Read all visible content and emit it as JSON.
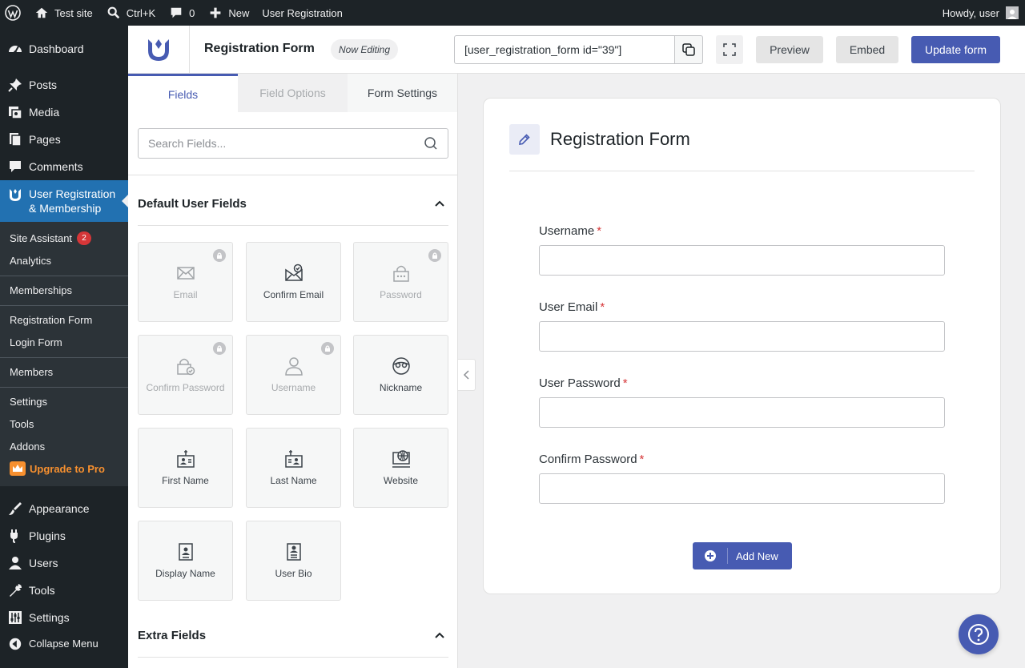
{
  "admin_bar": {
    "site_name": "Test site",
    "search_shortcut": "Ctrl+K",
    "comments_count": "0",
    "new_label": "New",
    "plugin_link": "User Registration",
    "greeting": "Howdy, user"
  },
  "sidebar": {
    "dashboard": "Dashboard",
    "posts": "Posts",
    "media": "Media",
    "pages": "Pages",
    "comments": "Comments",
    "user_registration": "User Registration & Membership",
    "submenu": {
      "site_assistant": "Site Assistant",
      "site_assistant_badge": "2",
      "analytics": "Analytics",
      "memberships": "Memberships",
      "registration_form": "Registration Form",
      "login_form": "Login Form",
      "members": "Members",
      "settings": "Settings",
      "tools": "Tools",
      "addons": "Addons",
      "upgrade": "Upgrade to Pro"
    },
    "appearance": "Appearance",
    "plugins": "Plugins",
    "users": "Users",
    "tools": "Tools",
    "settings": "Settings",
    "collapse": "Collapse Menu"
  },
  "header": {
    "form_title": "Registration Form",
    "status_badge": "Now Editing",
    "shortcode": "[user_registration_form id=\"39\"]",
    "preview": "Preview",
    "embed": "Embed",
    "update": "Update form"
  },
  "panel": {
    "tabs": [
      "Fields",
      "Field Options",
      "Form Settings"
    ],
    "search_placeholder": "Search Fields...",
    "default_section": "Default User Fields",
    "extra_section": "Extra Fields",
    "fields": [
      {
        "label": "Email",
        "icon": "envelope-icon",
        "locked": true
      },
      {
        "label": "Confirm Email",
        "icon": "envelope-check-icon",
        "locked": false
      },
      {
        "label": "Password",
        "icon": "lock-icon",
        "locked": true
      },
      {
        "label": "Confirm Password",
        "icon": "lock-check-icon",
        "locked": true
      },
      {
        "label": "Username",
        "icon": "user-icon",
        "locked": true
      },
      {
        "label": "Nickname",
        "icon": "mask-icon",
        "locked": false
      },
      {
        "label": "First Name",
        "icon": "id-badge-icon",
        "locked": false
      },
      {
        "label": "Last Name",
        "icon": "id-badge-icon",
        "locked": false
      },
      {
        "label": "Website",
        "icon": "globe-icon",
        "locked": false
      },
      {
        "label": "Display Name",
        "icon": "id-card-icon",
        "locked": false
      },
      {
        "label": "User Bio",
        "icon": "bio-icon",
        "locked": false
      }
    ]
  },
  "form": {
    "title": "Registration Form",
    "fields": [
      {
        "label": "Username",
        "required_mark": "*"
      },
      {
        "label": "User Email",
        "required_mark": "*"
      },
      {
        "label": "User Password",
        "required_mark": "*"
      },
      {
        "label": "Confirm Password",
        "required_mark": "*"
      }
    ],
    "add_new": "Add New"
  },
  "colors": {
    "accent": "#475bb2",
    "admin_dark": "#1d2327",
    "wp_blue": "#2271b1",
    "upgrade_orange": "#f7902f",
    "required_red": "#d63638"
  }
}
